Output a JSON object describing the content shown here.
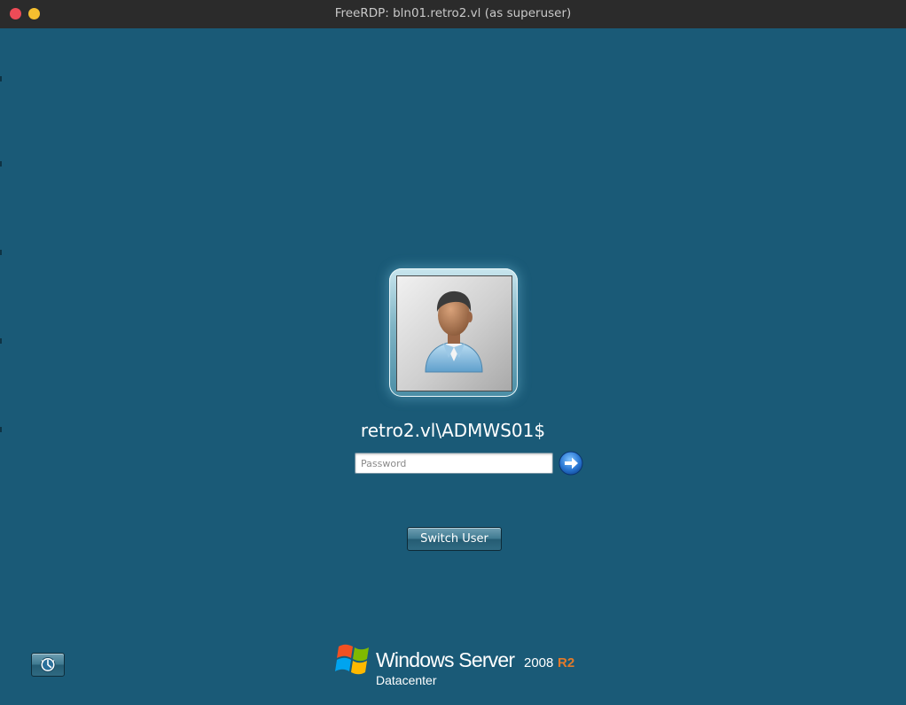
{
  "window": {
    "title": "FreeRDP: bln01.retro2.vl (as superuser)"
  },
  "logon": {
    "username": "retro2.vl\\ADMWS01$",
    "password_placeholder": "Password",
    "password_value": "",
    "switch_user_label": "Switch User"
  },
  "branding": {
    "product": "Windows Server",
    "version": "2008",
    "release": "R2",
    "edition": "Datacenter"
  },
  "icons": {
    "close": "close-dot-icon",
    "minimize": "minimize-dot-icon",
    "user_tile": "user-avatar-icon",
    "submit_arrow": "arrow-right-icon",
    "ease_of_access": "ease-of-access-icon",
    "windows_flag": "windows-flag-icon"
  },
  "colors": {
    "desktop_background": "#1a5a77",
    "titlebar": "#2b2b2b",
    "close_dot": "#ee4b57",
    "minimize_dot": "#f5bf2f",
    "r2_accent": "#e27a2a"
  }
}
